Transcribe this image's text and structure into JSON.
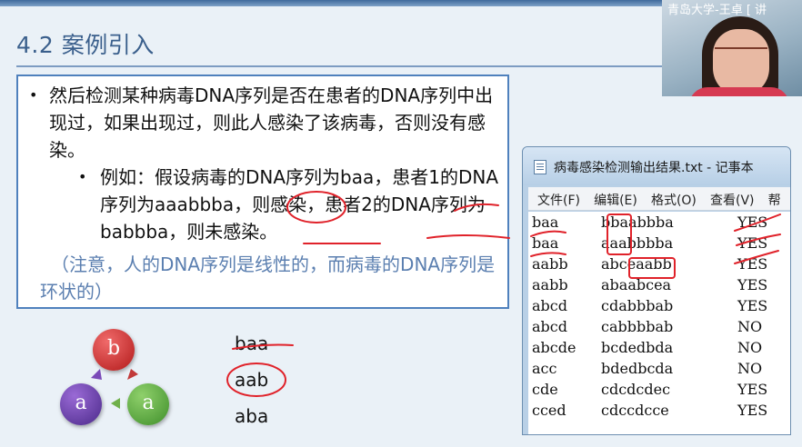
{
  "slide": {
    "title": "4.2 案例引入",
    "bullet_main": "然后检测某种病毒DNA序列是否在患者的DNA序列中出现过，如果出现过，则此人感染了该病毒，否则没有感染。",
    "bullet_sub": "例如：假设病毒的DNA序列为baa，患者1的DNA序列为aaabbba，则感染，患者2的DNA序列为babbba，则未感染。",
    "note": "（注意，人的DNA序列是线性的，而病毒的DNA序列是环状的）",
    "bullet_symbol": "•"
  },
  "webcam": {
    "label": "青岛大学-王卓 [ 讲"
  },
  "notepad": {
    "title": "病毒感染检测输出结果.txt - 记事本",
    "menu": [
      "文件(F)",
      "编辑(E)",
      "格式(O)",
      "查看(V)",
      "帮"
    ],
    "rows": [
      [
        "baa",
        "bbaabbba",
        "YES"
      ],
      [
        "baa",
        "aaabbbba",
        "YES"
      ],
      [
        "aabb",
        "abceaabb",
        "YES"
      ],
      [
        "aabb",
        "abaabcea",
        "YES"
      ],
      [
        "abcd",
        "cdabbbab",
        "YES"
      ],
      [
        "abcd",
        "cabbbbab",
        "NO"
      ],
      [
        "abcde",
        "bcdedbda",
        "NO"
      ],
      [
        "acc",
        "bdedbcda",
        "NO"
      ],
      [
        "cde",
        "cdcdcdec",
        "YES"
      ],
      [
        "cced",
        "cdccdcce",
        "YES"
      ]
    ]
  },
  "diagram": {
    "nodes": [
      "b",
      "a",
      "a"
    ],
    "sequences": [
      "baa",
      "aab",
      "aba"
    ]
  }
}
